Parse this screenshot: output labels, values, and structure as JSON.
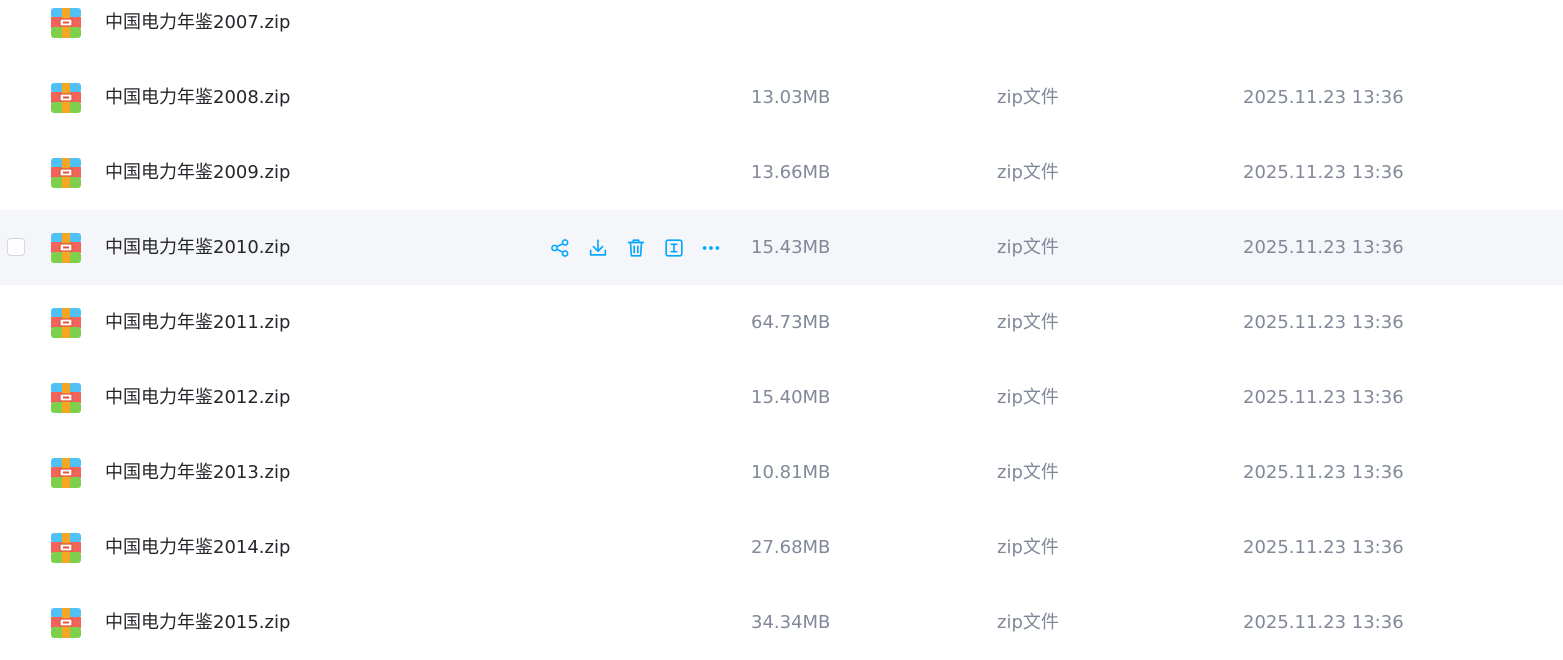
{
  "colors": {
    "accent": "#06a7ff",
    "text_primary": "#25262b",
    "text_secondary": "#818999",
    "row_hover_bg": "#f5f6fa"
  },
  "row_actions": [
    {
      "name": "share",
      "icon": "share-icon"
    },
    {
      "name": "download",
      "icon": "download-icon"
    },
    {
      "name": "delete",
      "icon": "trash-icon"
    },
    {
      "name": "rename",
      "icon": "rename-icon"
    },
    {
      "name": "more",
      "icon": "more-icon"
    }
  ],
  "files": [
    {
      "name": "中国电力年鉴2007.zip",
      "size": "",
      "type": "",
      "modified": "",
      "hovered": false
    },
    {
      "name": "中国电力年鉴2008.zip",
      "size": "13.03MB",
      "type": "zip文件",
      "modified": "2025.11.23 13:36",
      "hovered": false
    },
    {
      "name": "中国电力年鉴2009.zip",
      "size": "13.66MB",
      "type": "zip文件",
      "modified": "2025.11.23 13:36",
      "hovered": false
    },
    {
      "name": "中国电力年鉴2010.zip",
      "size": "15.43MB",
      "type": "zip文件",
      "modified": "2025.11.23 13:36",
      "hovered": true
    },
    {
      "name": "中国电力年鉴2011.zip",
      "size": "64.73MB",
      "type": "zip文件",
      "modified": "2025.11.23 13:36",
      "hovered": false
    },
    {
      "name": "中国电力年鉴2012.zip",
      "size": "15.40MB",
      "type": "zip文件",
      "modified": "2025.11.23 13:36",
      "hovered": false
    },
    {
      "name": "中国电力年鉴2013.zip",
      "size": "10.81MB",
      "type": "zip文件",
      "modified": "2025.11.23 13:36",
      "hovered": false
    },
    {
      "name": "中国电力年鉴2014.zip",
      "size": "27.68MB",
      "type": "zip文件",
      "modified": "2025.11.23 13:36",
      "hovered": false
    },
    {
      "name": "中国电力年鉴2015.zip",
      "size": "34.34MB",
      "type": "zip文件",
      "modified": "2025.11.23 13:36",
      "hovered": false
    }
  ]
}
